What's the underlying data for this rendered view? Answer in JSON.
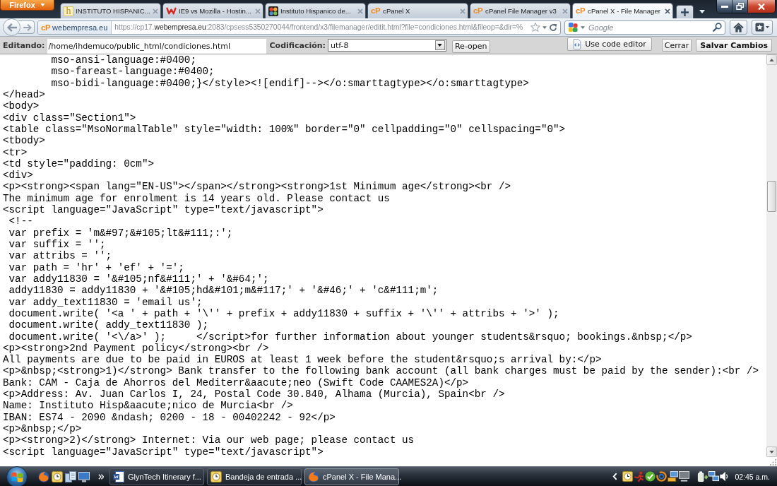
{
  "browser": {
    "menu_button": "Firefox",
    "tabs": [
      {
        "title": "INSTITUTO HISPANIC...",
        "kind": "tile",
        "icon_text": "h",
        "selected": false
      },
      {
        "title": "IE9 vs Mozilla - Hostin...",
        "kind": "mark",
        "selected": false
      },
      {
        "title": "Instituto Hispanico de...",
        "kind": "pinwheel",
        "selected": false
      },
      {
        "title": "cPanel X",
        "kind": "logo",
        "icon_text": "cP",
        "selected": false
      },
      {
        "title": "cPanel File Manager v3",
        "kind": "logo",
        "icon_text": "cP",
        "selected": false
      },
      {
        "title": "cPanel X - File Manager",
        "kind": "logo",
        "icon_text": "cP",
        "selected": true
      }
    ]
  },
  "navigation": {
    "site_identity": {
      "logo": "cP",
      "label": "webempresa.eu"
    },
    "url": {
      "before_domain": "https://cp17.",
      "domain": "webempresa.eu",
      "after_domain": ":2083/cpsess5350270044/frontend/x3/filemanager/editit.html?file=condiciones.html&fileop=&dir=%"
    },
    "search": {
      "placeholder": "Google"
    }
  },
  "editor_toolbar": {
    "editing_label": "Editando:",
    "path": "/home/ihdemuco/public_html/condiciones.html",
    "encoding_label": "Codificación:",
    "encoding": "utf-8",
    "reopen_button": "Re-open",
    "code_editor_button": "Use code editor",
    "close_button": "Cerrar",
    "save_button": "Salvar Cambios"
  },
  "code_lines": [
    "        mso-ansi-language:#0400;",
    "        mso-fareast-language:#0400;",
    "        mso-bidi-language:#0400;}</style><![endif]--></o:smarttagtype></o:smarttagtype>",
    "</head>",
    "<body>",
    "<div class=\"Section1\">",
    "<table class=\"MsoNormalTable\" style=\"width: 100%\" border=\"0\" cellpadding=\"0\" cellspacing=\"0\">",
    "<tbody>",
    "<tr>",
    "<td style=\"padding: 0cm\">",
    "<div>",
    "<p><strong><span lang=\"EN-US\"></span></strong><strong>1st Minimum age</strong><br />",
    "The minimum age for enrolment is 14 years old. Please contact us",
    "<script language=\"JavaScript\" type=\"text/javascript\">",
    " <!--",
    " var prefix = 'm&#97;&#105;lt&#111;:';",
    " var suffix = '';",
    " var attribs = '';",
    " var path = 'hr' + 'ef' + '=';",
    " var addy11830 = '&#105;nf&#111;' + '&#64;';",
    " addy11830 = addy11830 + '&#105;hd&#101;m&#117;' + '&#46;' + 'c&#111;m';",
    " var addy_text11830 = 'email us';",
    " document.write( '<a ' + path + '\\'' + prefix + addy11830 + suffix + '\\'' + attribs + '>' );",
    " document.write( addy_text11830 );",
    " document.write( '<\\/a>' );     </script>for further information about younger students&rsquo; bookings.&nbsp;</p>",
    "<p><strong>2nd Payment policy</strong><br />",
    "All payments are due to be paid in EUROS at least 1 week before the student&rsquo;s arrival by:</p>",
    "<p>&nbsp;<strong>1)</strong> Bank transfer to the following bank account (all bank charges must be paid by the sender):<br />",
    "Bank: CAM - Caja de Ahorros del Mediterr&aacute;neo (Swift Code CAAMES2A)</p>",
    "<p>Address: Av. Juan Carlos I, 24, Postal Code 30.840, Alhama (Murcia), Spain<br />",
    "Name: Instituto Hisp&aacute;nico de Murcia<br />",
    "IBAN: ES74 - 2090 &ndash; 0200 - 18 - 00402242 - 92</p>",
    "<p>&nbsp;</p>",
    "<p><strong>2)</strong> Internet: Via our web page; please contact us",
    "<script language=\"JavaScript\" type=\"text/javascript\">"
  ],
  "taskbar": {
    "tasks": [
      {
        "label": "GlynTech Itinerary f...",
        "kind": "document",
        "selected": false
      },
      {
        "label": "Bandeja de entrada ...",
        "kind": "mail",
        "selected": false
      },
      {
        "label": "cPanel X - File Mana...",
        "kind": "browser",
        "selected": true
      }
    ],
    "clock": "02:45 a.m."
  }
}
